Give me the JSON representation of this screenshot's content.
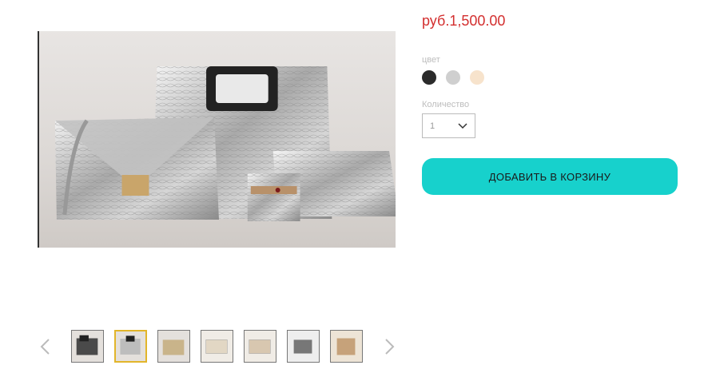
{
  "product": {
    "price": "руб.1,500.00",
    "image_alt": "silver crocodile leather bag set"
  },
  "color": {
    "label": "цвет",
    "swatches": [
      {
        "name": "black",
        "hex": "#2b2b2b"
      },
      {
        "name": "silver",
        "hex": "#cfcfcf"
      },
      {
        "name": "beige",
        "hex": "#f7e3cc"
      }
    ]
  },
  "quantity": {
    "label": "Количество",
    "value": "1"
  },
  "cart": {
    "add_label": "ДОБАВИТЬ В КОРЗИНУ",
    "accent": "#17d1cc"
  },
  "gallery": {
    "selected_index": 1,
    "thumbnails": [
      {
        "tone": "#4a4a4a"
      },
      {
        "tone": "#bdbdbd"
      },
      {
        "tone": "#c9b48a"
      },
      {
        "tone": "#e2d7c4"
      },
      {
        "tone": "#d8c7b0"
      },
      {
        "tone": "#777777"
      },
      {
        "tone": "#c6a27a"
      }
    ]
  }
}
